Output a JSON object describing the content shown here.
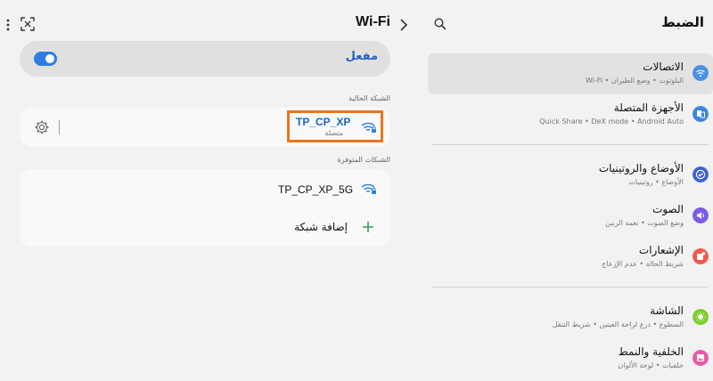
{
  "wifi_panel": {
    "title": "Wi-Fi",
    "toggle_label": "مفعل",
    "toggle_on": true,
    "current_section_label": "الشبكة الحالية",
    "current_network": {
      "name": "TP_CP_XP",
      "status": "متصلة"
    },
    "available_section_label": "الشبكات المتوفرة",
    "available_networks": [
      {
        "name": "TP_CP_XP_5G"
      }
    ],
    "add_network_label": "إضافة شبكة"
  },
  "settings_panel": {
    "title": "الضبط",
    "items": [
      {
        "title": "الاتصالات",
        "subtitle": "Wi-Fi • البلوتوث • وضع الطيران",
        "icon": "wifi-icon",
        "color": "#4a8fe7"
      },
      {
        "title": "الأجهزة المتصلة",
        "subtitle": "Quick Share • DeX mode • Android Auto",
        "icon": "connected-devices-icon",
        "color": "#3b86e0"
      },
      {
        "title": "الأوضاع والروتينيات",
        "subtitle": "الأوضاع • روتينيات",
        "icon": "modes-check-icon",
        "color": "#3e62d8"
      },
      {
        "title": "الصوت",
        "subtitle": "وضع الصوت • نغمة الرنين",
        "icon": "volume-icon",
        "color": "#7b5ce6"
      },
      {
        "title": "الإشعارات",
        "subtitle": "شريط الحالة • عدم الإزعاج",
        "icon": "notification-icon",
        "color": "#f0584f"
      },
      {
        "title": "الشاشة",
        "subtitle": "السطوع • درع لراحة العينين • شريط التنقل",
        "icon": "brightness-icon",
        "color": "#7ccc2a"
      },
      {
        "title": "الخلفية والنمط",
        "subtitle": "خلفيات • لوحة الألوان",
        "icon": "wallpaper-icon",
        "color": "#e85aa3"
      }
    ]
  },
  "colors": {
    "accent": "#1f63c4",
    "toggle": "#2f7de1",
    "highlight": "#e8761f",
    "add_plus": "#2e9e5b"
  }
}
